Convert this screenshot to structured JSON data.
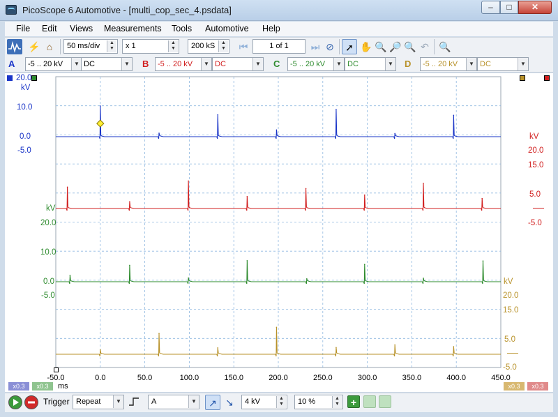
{
  "window": {
    "title": "PicoScope 6 Automotive - [multi_cop_sec_4.psdata]",
    "min": "‒",
    "max": "□",
    "close": "✕"
  },
  "menu": [
    "File",
    "Edit",
    "Views",
    "Measurements",
    "Tools",
    "Automotive",
    "Help"
  ],
  "toolbar": {
    "timebase": "50 ms/div",
    "zoom": "x 1",
    "samples": "200 kS",
    "buffer": "1 of 1"
  },
  "channels": {
    "A": {
      "letter": "A",
      "range": "-5 .. 20 kV",
      "coupling": "DC",
      "color": "#1a35c8"
    },
    "B": {
      "letter": "B",
      "range": "-5 .. 20 kV",
      "coupling": "DC",
      "color": "#d11f1f"
    },
    "C": {
      "letter": "C",
      "range": "-5 .. 20 kV",
      "coupling": "DC",
      "color": "#2e8b2e"
    },
    "D": {
      "letter": "D",
      "range": "-5 .. 20 kV",
      "coupling": "DC",
      "color": "#b8922a"
    }
  },
  "axes": {
    "blue": [
      "20.0",
      "kV",
      "10.0",
      "0.0",
      "-5.0"
    ],
    "red": [
      "kV",
      "20.0",
      "15.0",
      "5.0",
      "-5.0"
    ],
    "green": [
      "kV",
      "20.0",
      "10.0",
      "0.0",
      "-5.0"
    ],
    "gold": [
      "kV",
      "20.0",
      "15.0",
      "5.0",
      "-5.0"
    ],
    "x_ticks": [
      "-50.0",
      "0.0",
      "50.0",
      "100.0",
      "150.0",
      "200.0",
      "250.0",
      "300.0",
      "350.0",
      "400.0",
      "450.0"
    ],
    "x_unit": "ms",
    "badges": [
      "x0.3",
      "x0.3",
      "x0.3",
      "x0.3"
    ]
  },
  "status": {
    "trigger_label": "Trigger",
    "trigger_mode": "Repeat",
    "trigger_source": "A",
    "threshold": "4 kV",
    "pre_trigger": "10 %"
  },
  "chart_data": {
    "type": "line",
    "xlabel": "ms",
    "xlim": [
      -50,
      450
    ],
    "series": [
      {
        "name": "A",
        "color": "#1a35c8",
        "baseline": 0.0,
        "spikes": [
          [
            0,
            10.5
          ],
          [
            66,
            1.2
          ],
          [
            132,
            7.5
          ],
          [
            198,
            2.3
          ],
          [
            265,
            9.3
          ],
          [
            331,
            1.1
          ],
          [
            397,
            7.3
          ]
        ]
      },
      {
        "name": "B",
        "color": "#d11f1f",
        "baseline": 0.0,
        "spikes": [
          [
            -37,
            7.3
          ],
          [
            33,
            2.3
          ],
          [
            99,
            9.4
          ],
          [
            165,
            4.1
          ],
          [
            231,
            6.8
          ],
          [
            297,
            4.6
          ],
          [
            363,
            8.6
          ],
          [
            429,
            3.4
          ]
        ]
      },
      {
        "name": "C",
        "color": "#2e8b2e",
        "baseline": 0.0,
        "spikes": [
          [
            -34,
            2.2
          ],
          [
            33,
            5.6
          ],
          [
            99,
            1.3
          ],
          [
            165,
            7.2
          ],
          [
            232,
            1.0
          ],
          [
            297,
            5.9
          ],
          [
            363,
            1.2
          ],
          [
            430,
            7.1
          ]
        ]
      },
      {
        "name": "D",
        "color": "#b8922a",
        "baseline": 0.0,
        "spikes": [
          [
            0,
            1.5
          ],
          [
            66,
            7.1
          ],
          [
            132,
            2.2
          ],
          [
            198,
            9.2
          ],
          [
            265,
            2.3
          ],
          [
            331,
            3.2
          ],
          [
            397,
            2.6
          ]
        ]
      }
    ]
  }
}
